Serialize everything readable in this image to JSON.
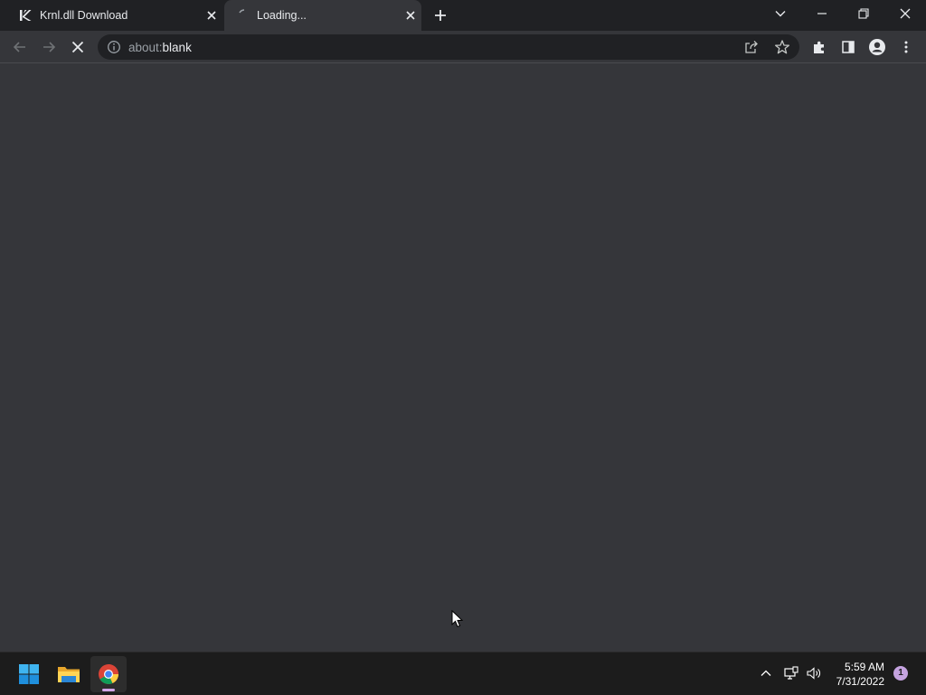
{
  "browser": {
    "tabs": [
      {
        "title": "Krnl.dll Download",
        "favicon": "krnl-logo-icon",
        "active": false
      },
      {
        "title": "Loading...",
        "favicon": "loading-spinner-icon",
        "active": true
      }
    ],
    "address_bar": {
      "scheme": "about:",
      "host": "blank"
    }
  },
  "taskbar": {
    "apps": [
      {
        "name": "start",
        "icon": "windows-start-icon"
      },
      {
        "name": "file-explorer",
        "icon": "folder-icon"
      },
      {
        "name": "chrome",
        "icon": "chrome-icon",
        "running": true
      }
    ],
    "clock": {
      "time": "5:59 AM",
      "date": "7/31/2022"
    },
    "notification_count": "1"
  },
  "colors": {
    "tab_strip": "#202124",
    "toolbar": "#35363a",
    "content": "#35363a",
    "taskbar": "#1c1c1c",
    "notification_badge": "#c5a3e0"
  }
}
